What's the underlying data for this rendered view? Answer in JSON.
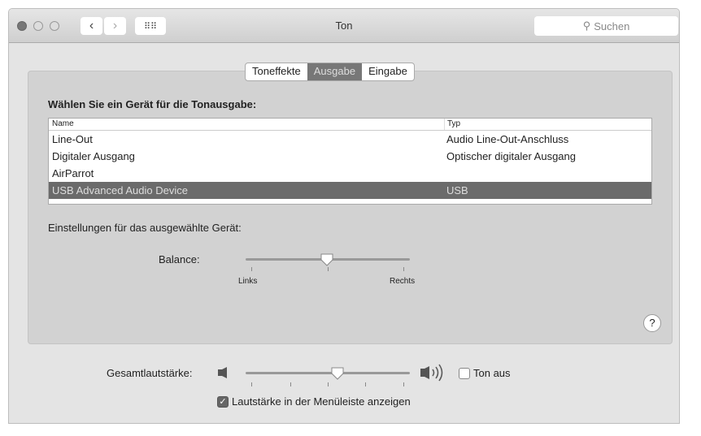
{
  "window": {
    "title": "Ton",
    "search_placeholder": "Suchen"
  },
  "tabs": [
    {
      "label": "Toneffekte",
      "selected": false
    },
    {
      "label": "Ausgabe",
      "selected": true
    },
    {
      "label": "Eingabe",
      "selected": false
    }
  ],
  "output": {
    "heading": "Wählen Sie ein Gerät für die Tonausgabe:",
    "columns": [
      "Name",
      "Typ"
    ],
    "rows": [
      {
        "name": "Line-Out",
        "type": "Audio Line-Out-Anschluss"
      },
      {
        "name": "Digitaler Ausgang",
        "type": "Optischer digitaler Ausgang"
      },
      {
        "name": "AirParrot",
        "type": ""
      },
      {
        "name": "USB Advanced Audio Device",
        "type": "USB",
        "selected": true
      }
    ],
    "settings_label": "Einstellungen für das ausgewählte Gerät:",
    "balance": {
      "label": "Balance:",
      "left": "Links",
      "right": "Rechts",
      "value": 0.5
    }
  },
  "volume": {
    "label": "Gesamtlautstärke:",
    "value": 0.57,
    "mute_label": "Ton aus",
    "mute": false,
    "menubar_label": "Lautstärke in der Menüleiste anzeigen",
    "menubar": true
  },
  "help": "?"
}
